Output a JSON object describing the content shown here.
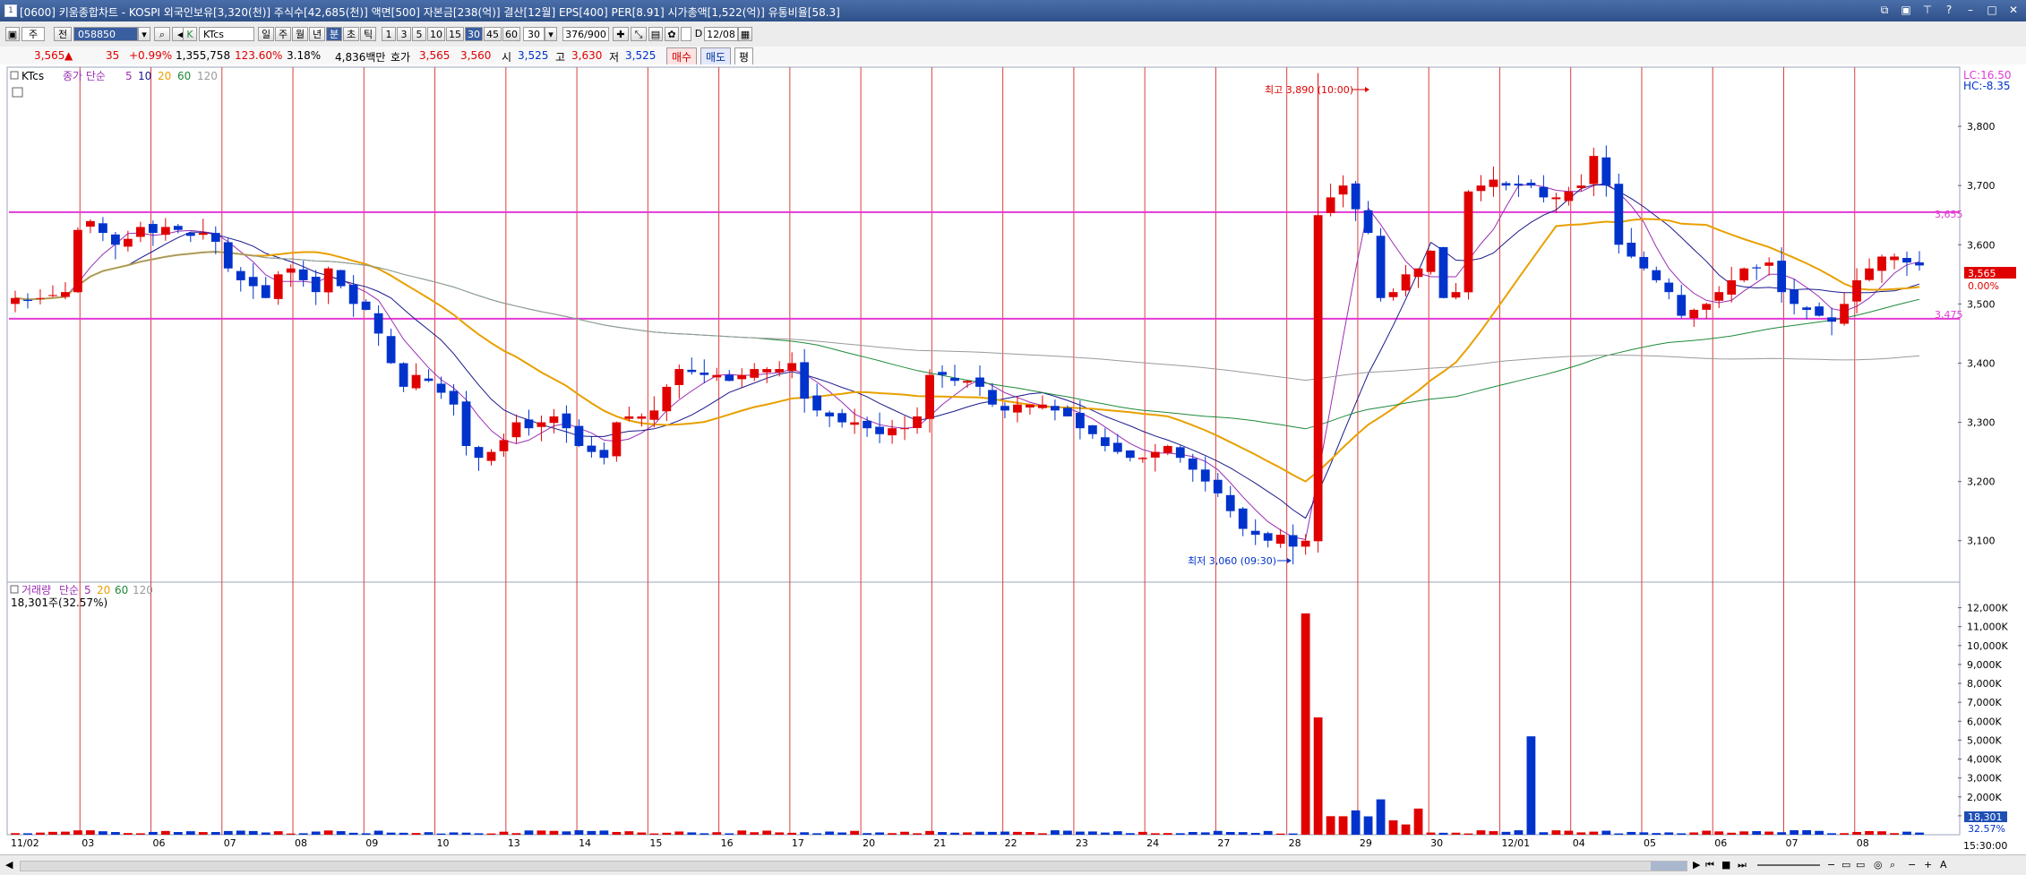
{
  "window": {
    "title": "[0600] 키움종합차트 - KOSPI 외국인보유[3,320(천)] 주식수[42,685(천)] 액면[500] 자본금[238(억)] 결산[12월] EPS[400] PER[8.91] 시가총액[1,522(억)] 유통비율[58.3]",
    "icon": "chart-app-icon"
  },
  "toolbar": {
    "items": [
      "주",
      "전",
      "058850",
      "KTcs",
      "일",
      "주",
      "월",
      "년",
      "분",
      "초",
      "틱",
      "1",
      "3",
      "5",
      "10",
      "15",
      "30",
      "45",
      "60",
      "30",
      "376/900",
      "D",
      "12/08"
    ],
    "selected_period": "분",
    "selected_minute": "30"
  },
  "quote": {
    "price": "3,565",
    "arrow": "▲",
    "change": "35",
    "change_pct": "+0.99%",
    "volume": "1,355,758",
    "vol_ratio": "123.60%",
    "turnover": "3.18%",
    "amount": "4,836백만",
    "ask_label": "호가",
    "ask": "3,565",
    "bid": "3,560",
    "open_label": "시",
    "open": "3,525",
    "high_label": "고",
    "high": "3,630",
    "low_label": "저",
    "low": "3,525",
    "buy": "매수",
    "sell": "매도",
    "eval": "평"
  },
  "price_panel": {
    "legend_name": "KTcs",
    "legend_ma": "종가 단순",
    "ma_periods": [
      "5",
      "10",
      "20",
      "60",
      "120"
    ],
    "lc": "LC:16.50",
    "hc": "HC:-8.35",
    "y_ticks": [
      "3,800",
      "3,700",
      "3,600",
      "3,500",
      "3,400",
      "3,300",
      "3,200",
      "3,100"
    ],
    "level_high": "3,655",
    "level_low": "3,475",
    "current_price_tag": "3,565",
    "current_pct_tag": "0.00%",
    "max_label": "최고 3,890 (10:00)",
    "min_label": "최저 3,060 (09:30)"
  },
  "volume_panel": {
    "legend_name": "거래량",
    "legend_ma": "단순",
    "ma_periods": [
      "5",
      "20",
      "60",
      "120"
    ],
    "info": "18,301주(32.57%)",
    "y_ticks": [
      "12,000K",
      "11,000K",
      "10,000K",
      "9,000K",
      "8,000K",
      "7,000K",
      "6,000K",
      "5,000K",
      "4,000K",
      "3,000K",
      "2,000K",
      "1,000K"
    ],
    "current_tag": "18,301",
    "current_pct": "32.57%"
  },
  "x_axis": {
    "labels": [
      "11/02",
      "03",
      "06",
      "07",
      "08",
      "09",
      "10",
      "13",
      "14",
      "15",
      "16",
      "17",
      "20",
      "21",
      "22",
      "23",
      "24",
      "27",
      "28",
      "29",
      "30",
      "12/01",
      "04",
      "05",
      "06",
      "07",
      "08"
    ],
    "time_label": "15:30:00"
  },
  "colors": {
    "up": "#e00000",
    "down": "#0033cc",
    "ma5": "#9b2fb5",
    "ma10": "#1a1a8c",
    "ma20": "#e8a000",
    "ma60": "#1e8a3a",
    "ma120": "#9a9a9a",
    "level": "#e23ad6",
    "session_line": "#d94040"
  },
  "chart_data": {
    "type": "candlestick",
    "interval": "30min",
    "price_range": [
      3030,
      3900
    ],
    "closes": [
      3510,
      3505,
      3510,
      3515,
      3520,
      3625,
      3640,
      3620,
      3600,
      3610,
      3630,
      3620,
      3630,
      3625,
      3615,
      3620,
      3605,
      3560,
      3540,
      3530,
      3510,
      3550,
      3560,
      3540,
      3520,
      3560,
      3530,
      3500,
      3490,
      3450,
      3400,
      3360,
      3380,
      3370,
      3350,
      3330,
      3260,
      3240,
      3250,
      3270,
      3300,
      3290,
      3300,
      3310,
      3290,
      3260,
      3250,
      3240,
      3300,
      3310,
      3310,
      3320,
      3360,
      3390,
      3385,
      3380,
      3380,
      3370,
      3380,
      3390,
      3390,
      3390,
      3400,
      3340,
      3320,
      3310,
      3300,
      3300,
      3290,
      3280,
      3290,
      3290,
      3310,
      3380,
      3380,
      3370,
      3370,
      3360,
      3330,
      3320,
      3330,
      3330,
      3330,
      3320,
      3310,
      3290,
      3280,
      3260,
      3250,
      3240,
      3240,
      3250,
      3260,
      3240,
      3220,
      3200,
      3180,
      3150,
      3120,
      3110,
      3100,
      3110,
      3090,
      3100,
      3650,
      3680,
      3700,
      3660,
      3620,
      3510,
      3520,
      3550,
      3560,
      3590,
      3510,
      3520,
      3690,
      3700,
      3710,
      3700,
      3700,
      3700,
      3680,
      3680,
      3690,
      3700,
      3750,
      3700,
      3600,
      3580,
      3560,
      3540,
      3520,
      3480,
      3490,
      3500,
      3520,
      3540,
      3560,
      3560,
      3570,
      3520,
      3500,
      3490,
      3480,
      3470,
      3500,
      3540,
      3560,
      3580,
      3580,
      3570,
      3565
    ],
    "volume_spikes": [
      {
        "session": "29",
        "value": 11700000
      },
      {
        "session": "29",
        "value": 6200000
      },
      {
        "session": "12/01",
        "value": 5200000
      }
    ],
    "levels": [
      3655,
      3475
    ],
    "max": {
      "value": 3890,
      "time": "10:00"
    },
    "min": {
      "value": 3060,
      "time": "09:30"
    }
  },
  "statusbar": {
    "time": "15:30:00"
  }
}
